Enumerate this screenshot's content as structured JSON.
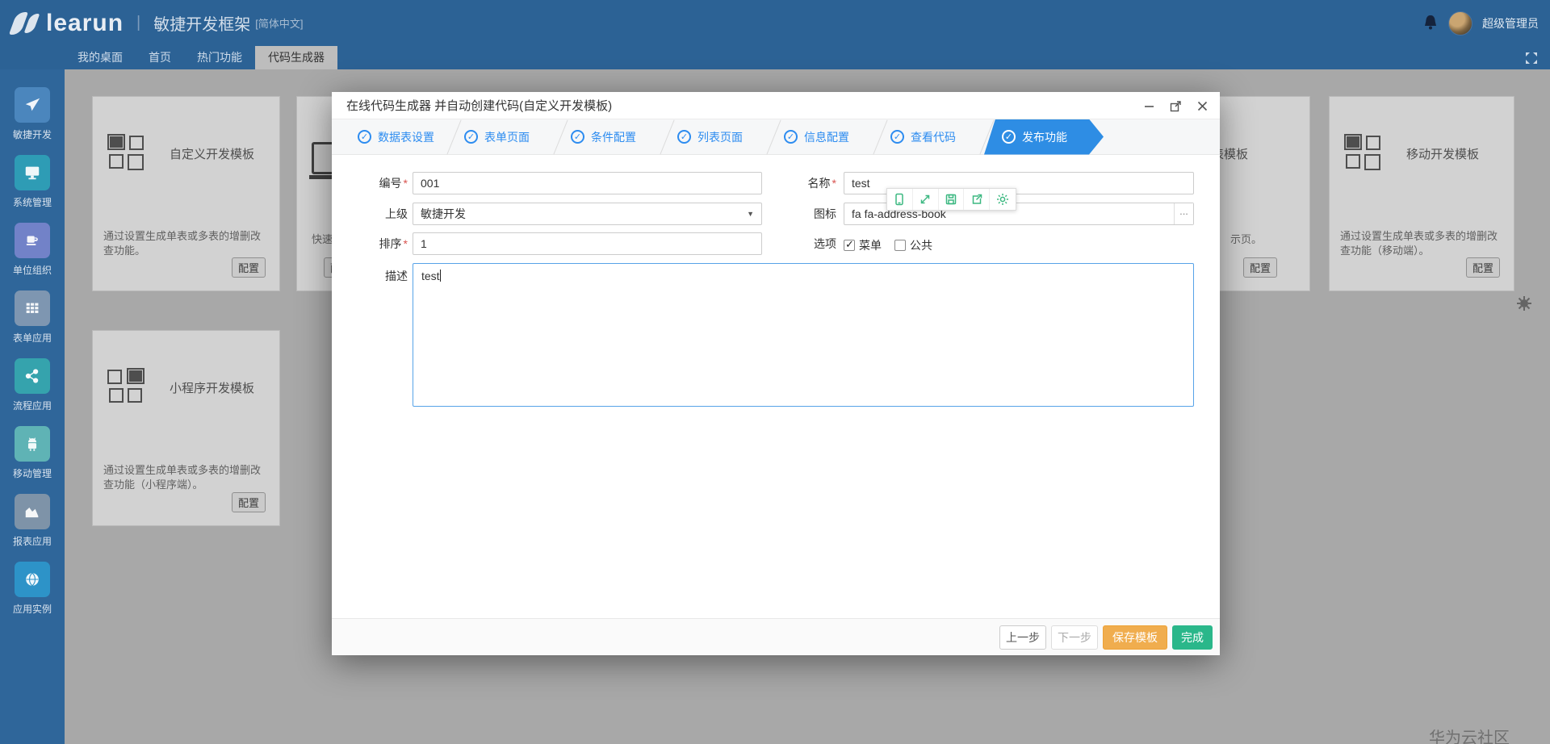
{
  "header": {
    "logo_text": "learun",
    "separator": "|",
    "product_name": "敏捷开发框架",
    "language": "[简体中文]",
    "username": "超级管理员"
  },
  "tabs": [
    {
      "label": "我的桌面",
      "active": false
    },
    {
      "label": "首页",
      "active": false
    },
    {
      "label": "热门功能",
      "active": false
    },
    {
      "label": "代码生成器",
      "active": true
    }
  ],
  "sidebar": {
    "items": [
      {
        "label": "敏捷开发",
        "icon": "paper-plane-icon",
        "tile_color": "#4b86bd"
      },
      {
        "label": "系统管理",
        "icon": "monitor-icon",
        "tile_color": "#2e9cb5"
      },
      {
        "label": "单位组织",
        "icon": "coffee-cup-icon",
        "tile_color": "#7282c8"
      },
      {
        "label": "表单应用",
        "icon": "table-grid-icon",
        "tile_color": "#7e96b1"
      },
      {
        "label": "流程应用",
        "icon": "share-nodes-icon",
        "tile_color": "#35a3ad"
      },
      {
        "label": "移动管理",
        "icon": "android-icon",
        "tile_color": "#5fb3b5"
      },
      {
        "label": "报表应用",
        "icon": "area-chart-icon",
        "tile_color": "#7e93a8"
      },
      {
        "label": "应用实例",
        "icon": "globe-icon",
        "tile_color": "#2d93c8"
      }
    ]
  },
  "cards": {
    "config_label": "配置",
    "custom": {
      "title": "自定义开发模板",
      "description": "通过设置生成单表或多表的增删改查功能。"
    },
    "partial_left": {
      "visible_text": "快速"
    },
    "partial_right": {
      "title_visible": "报表模板",
      "description_visible": "示页。"
    },
    "mobile": {
      "title": "移动开发模板",
      "description": "通过设置生成单表或多表的增删改查功能（移动端）。"
    },
    "miniprogram": {
      "title": "小程序开发模板",
      "description": "通过设置生成单表或多表的增删改查功能（小程序端）。"
    }
  },
  "modal": {
    "title": "在线代码生成器 并自动创建代码(自定义开发模板)",
    "steps": [
      {
        "label": "数据表设置",
        "state": "done"
      },
      {
        "label": "表单页面",
        "state": "done"
      },
      {
        "label": "条件配置",
        "state": "done"
      },
      {
        "label": "列表页面",
        "state": "done"
      },
      {
        "label": "信息配置",
        "state": "done"
      },
      {
        "label": "查看代码",
        "state": "done"
      },
      {
        "label": "发布功能",
        "state": "active"
      }
    ],
    "check_glyph": "✓",
    "form": {
      "required_mark": "*",
      "code_label": "编号",
      "code_value": "001",
      "name_label": "名称",
      "name_value": "test",
      "parent_label": "上级",
      "parent_value": "敏捷开发",
      "icon_label": "图标",
      "icon_value": "fa fa-address-book",
      "icon_more": "...",
      "sort_label": "排序",
      "sort_value": "1",
      "options_label": "选项",
      "option_menu": "菜单",
      "option_menu_checked": true,
      "option_public": "公共",
      "option_public_checked": false,
      "desc_label": "描述",
      "desc_value": "test"
    },
    "footer": {
      "prev": "上一步",
      "next": "下一步",
      "save": "保存模板",
      "finish": "完成"
    },
    "floating_toolbar_icons": [
      "mobile-icon",
      "expand-icon",
      "save-icon",
      "export-icon",
      "gear-icon"
    ]
  },
  "watermark": "华为云社区",
  "colors": {
    "header_blue": "#2c6295",
    "sidebar_blue": "#2f669a",
    "step_blue": "#2d8cf0",
    "active_step_blue": "#2e8de4",
    "active_tab_gray": "#bdbdbd",
    "warning_orange": "#f0ad4e",
    "success_green": "#2ab78a",
    "toolbar_green": "#3cb881",
    "focused_border_blue": "#57a3e8",
    "required_red": "#d9534f"
  }
}
